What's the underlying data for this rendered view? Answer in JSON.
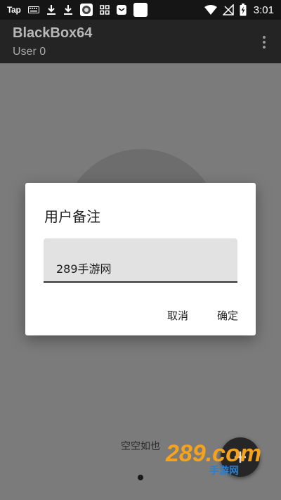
{
  "status_bar": {
    "tap_label": "Tap",
    "time": "3:01",
    "icons": [
      "keyboard-icon",
      "download-icon",
      "download-icon",
      "game-app-icon",
      "grid-icon",
      "mail-icon",
      "square-icon",
      "wifi-icon",
      "no-signal-icon",
      "battery-charging-icon"
    ]
  },
  "app_bar": {
    "title": "BlackBox64",
    "subtitle": "User 0",
    "menu_icon": "more-vert-icon"
  },
  "content": {
    "empty_text": "空空如也",
    "fab_icon": "add-icon"
  },
  "dialog": {
    "title": "用户备注",
    "input_value": "289手游网",
    "cancel_label": "取消",
    "confirm_label": "确定"
  },
  "watermark": {
    "logo_text": "289.com",
    "sub_text": "手游网",
    "colors": {
      "orange": "#f7a21b",
      "blue": "#2a7fd0"
    }
  }
}
